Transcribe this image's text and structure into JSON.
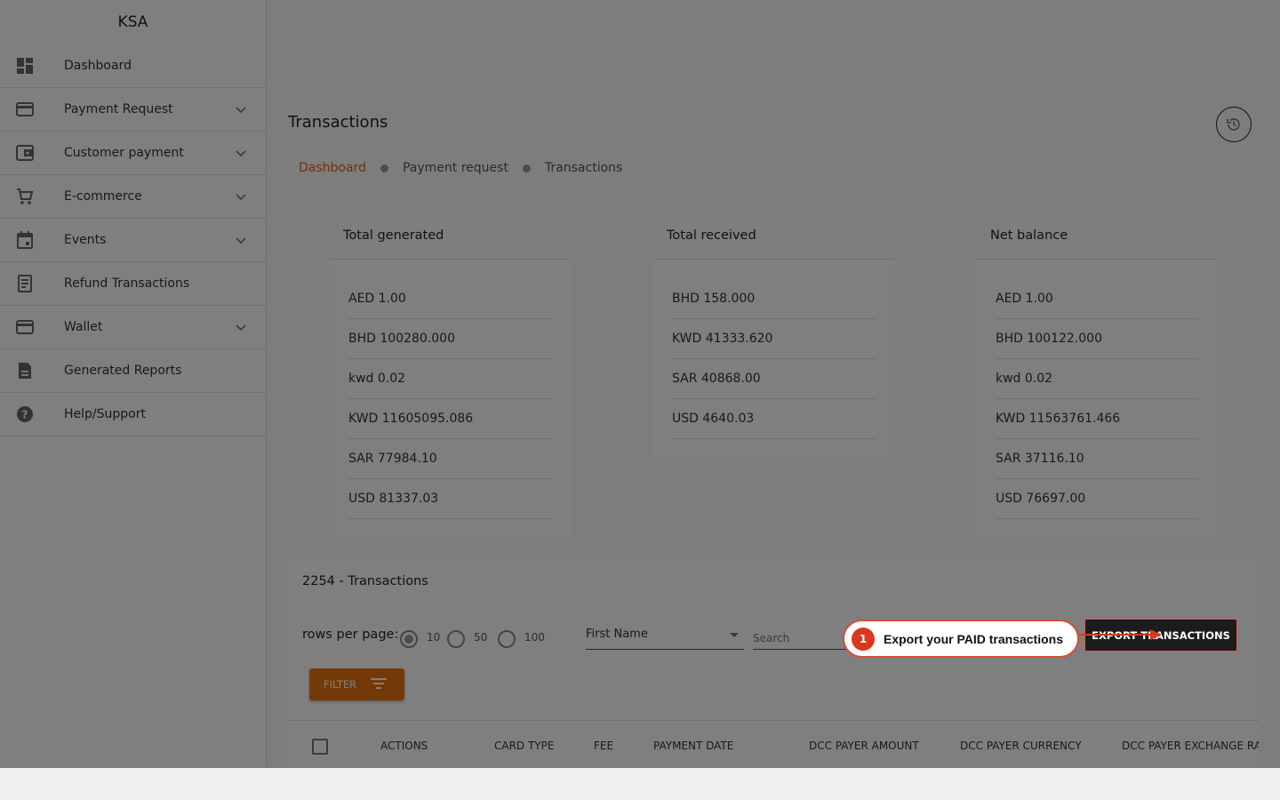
{
  "sidebar": {
    "brand": "KSA",
    "items": [
      {
        "label": "Dashboard",
        "icon": "dashboard-icon",
        "expandable": false
      },
      {
        "label": "Payment Request",
        "icon": "credit-card-icon",
        "expandable": true
      },
      {
        "label": "Customer payment",
        "icon": "wallet-card-icon",
        "expandable": true
      },
      {
        "label": "E-commerce",
        "icon": "cart-icon",
        "expandable": true
      },
      {
        "label": "Events",
        "icon": "calendar-icon",
        "expandable": true
      },
      {
        "label": "Refund Transactions",
        "icon": "receipt-icon",
        "expandable": false
      },
      {
        "label": "Wallet",
        "icon": "wallet-icon",
        "expandable": true
      },
      {
        "label": "Generated Reports",
        "icon": "report-icon",
        "expandable": false
      },
      {
        "label": "Help/Support",
        "icon": "help-icon",
        "expandable": false
      }
    ]
  },
  "page": {
    "title": "Transactions",
    "breadcrumb": [
      "Dashboard",
      "Payment request",
      "Transactions"
    ]
  },
  "cards": [
    {
      "title": "Total generated",
      "rows": [
        "AED 1.00",
        "BHD 100280.000",
        "kwd 0.02",
        "KWD 11605095.086",
        "SAR 77984.10",
        "USD 81337.03"
      ]
    },
    {
      "title": "Total received",
      "rows": [
        "BHD 158.000",
        "KWD 41333.620",
        "SAR 40868.00",
        "USD 4640.03"
      ]
    },
    {
      "title": "Net balance",
      "rows": [
        "AED 1.00",
        "BHD 100122.000",
        "kwd 0.02",
        "KWD 11563761.466",
        "SAR 37116.10",
        "USD 76697.00"
      ]
    }
  ],
  "transactions": {
    "count_label": "2254 - Transactions",
    "rows_per_page_label": "rows per page:",
    "rows_options": [
      "10",
      "50",
      "100"
    ],
    "rows_selected": "10",
    "select_value": "First Name",
    "search_placeholder": "Search",
    "export_label": "EXPORT TRANSACTIONS",
    "filter_label": "FILTER",
    "columns": [
      "ACTIONS",
      "CARD TYPE",
      "FEE",
      "PAYMENT DATE",
      "DCC PAYER AMOUNT",
      "DCC PAYER CURRENCY",
      "DCC PAYER EXCHANGE RA"
    ]
  },
  "tour": {
    "step": "1",
    "text": "Export your PAID transactions"
  },
  "colors": {
    "accent": "#e8620c",
    "filter_button": "#e8730e",
    "badge": "#d9381e",
    "overlay": "rgba(0,0,0,0.5)"
  }
}
